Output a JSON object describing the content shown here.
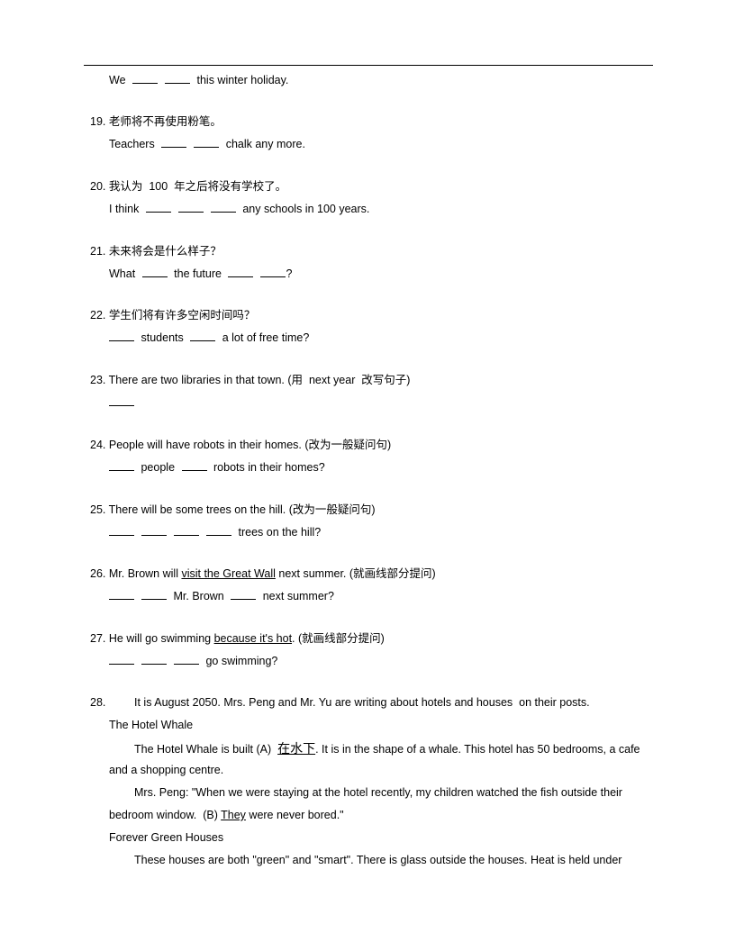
{
  "continuation": {
    "answer_prefix": "We",
    "answer_suffix": "this winter holiday."
  },
  "questions": [
    {
      "num": "19.",
      "prompt": "老师将不再使用粉笔。",
      "answer_prefix": "Teachers",
      "answer_suffix": "chalk any more."
    },
    {
      "num": "20.",
      "prompt": "我认为  100  年之后将没有学校了。",
      "answer_prefix": "I think",
      "answer_suffix": "any schools in 100 years."
    },
    {
      "num": "21.",
      "prompt": "未来将会是什么样子？",
      "answer_prefix": "What",
      "answer_middle": "the future",
      "answer_suffix": "?"
    },
    {
      "num": "22.",
      "prompt": "学生们将有许多空闲时间吗？",
      "answer_middle": "students",
      "answer_suffix": "a lot of free time?"
    },
    {
      "num": "23.",
      "prompt": "There are two libraries in that town. (用  next year  改写句子)"
    },
    {
      "num": "24.",
      "prompt": "People will have robots in their homes. (改为一般疑问句)",
      "answer_middle": "people",
      "answer_suffix": "robots in their homes?"
    },
    {
      "num": "25.",
      "prompt": "There will be some trees on the hill. (改为一般疑问句)",
      "answer_suffix": "trees on the hill?"
    },
    {
      "num": "26.",
      "prompt_before": "Mr. Brown will ",
      "prompt_underlined": "visit the Great Wall",
      "prompt_after": " next summer. (就画线部分提问)",
      "answer_middle": "Mr. Brown",
      "answer_suffix": "next summer?"
    },
    {
      "num": "27.",
      "prompt_before": "He will go swimming ",
      "prompt_underlined": "because it's hot",
      "prompt_after": ". (就画线部分提问)",
      "answer_suffix": "go swimming?"
    }
  ],
  "reading": {
    "num": "28.",
    "intro": "It is August 2050. Mrs. Peng and Mr. Yu are writing about hotels and houses  on their posts.",
    "section1_title": "The Hotel Whale",
    "p1_before": "The Hotel Whale is built (A)  ",
    "p1_underlined": "在水下",
    "p1_after": ". It is in the shape of a whale. This hotel has 50 bedrooms, a cafe",
    "p1_line2": "and a shopping  centre.",
    "p2_line1": "Mrs. Peng: \"When we were staying at the hotel recently, my children watched the fish outside their",
    "p2_before": "bedroom window.  (B) ",
    "p2_underlined": "They",
    "p2_after": " were never bored.\"",
    "section2_title": "Forever Green Houses",
    "p3_line1": "These houses are both \"green\" and \"smart\". There is glass outside the houses. Heat is held under"
  }
}
